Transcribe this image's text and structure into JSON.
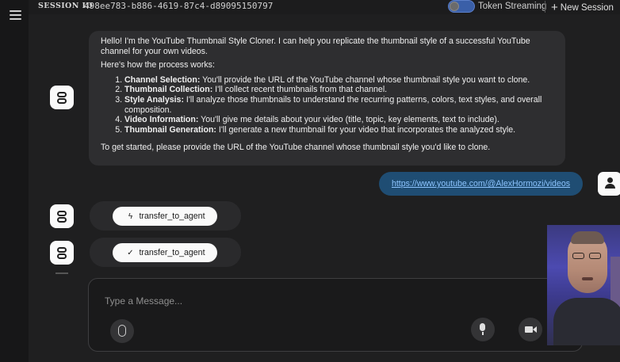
{
  "header": {
    "session_label": "SESSION ID",
    "session_id": "498ee783-b886-4619-87c4-d89095150797",
    "streaming_label": "Token Streaming",
    "new_session_label": "New Session"
  },
  "chat": {
    "assistant_message": {
      "intro": "Hello! I'm the YouTube Thumbnail Style Cloner. I can help you replicate the thumbnail style of a successful YouTube channel for your own videos.",
      "process_heading": "Here's how the process works:",
      "steps": [
        {
          "title": "Channel Selection:",
          "text": " You'll provide the URL of the YouTube channel whose thumbnail style you want to clone."
        },
        {
          "title": "Thumbnail Collection:",
          "text": " I'll collect recent thumbnails from that channel."
        },
        {
          "title": "Style Analysis:",
          "text": " I'll analyze those thumbnails to understand the recurring patterns, colors, text styles, and overall composition."
        },
        {
          "title": "Video Information:",
          "text": " You'll give me details about your video (title, topic, key elements, text to include)."
        },
        {
          "title": "Thumbnail Generation:",
          "text": " I'll generate a new thumbnail for your video that incorporates the analyzed style."
        }
      ],
      "closing": "To get started, please provide the URL of the YouTube channel whose thumbnail style you'd like to clone."
    },
    "user_message": "https://www.youtube.com/@AlexHormozi/videos",
    "tool_calls": [
      {
        "label": "transfer_to_agent",
        "icon": "lightning-icon",
        "glyph": "ϟ"
      },
      {
        "label": "transfer_to_agent",
        "icon": "check-icon",
        "glyph": "✓"
      }
    ]
  },
  "composer": {
    "placeholder": "Type a Message..."
  },
  "colors": {
    "background": "#1f1f20",
    "bubble": "#2e2e30",
    "user_bubble": "#1f4d73",
    "link": "#8cc4ff",
    "toggle": "#3a5fa8"
  }
}
